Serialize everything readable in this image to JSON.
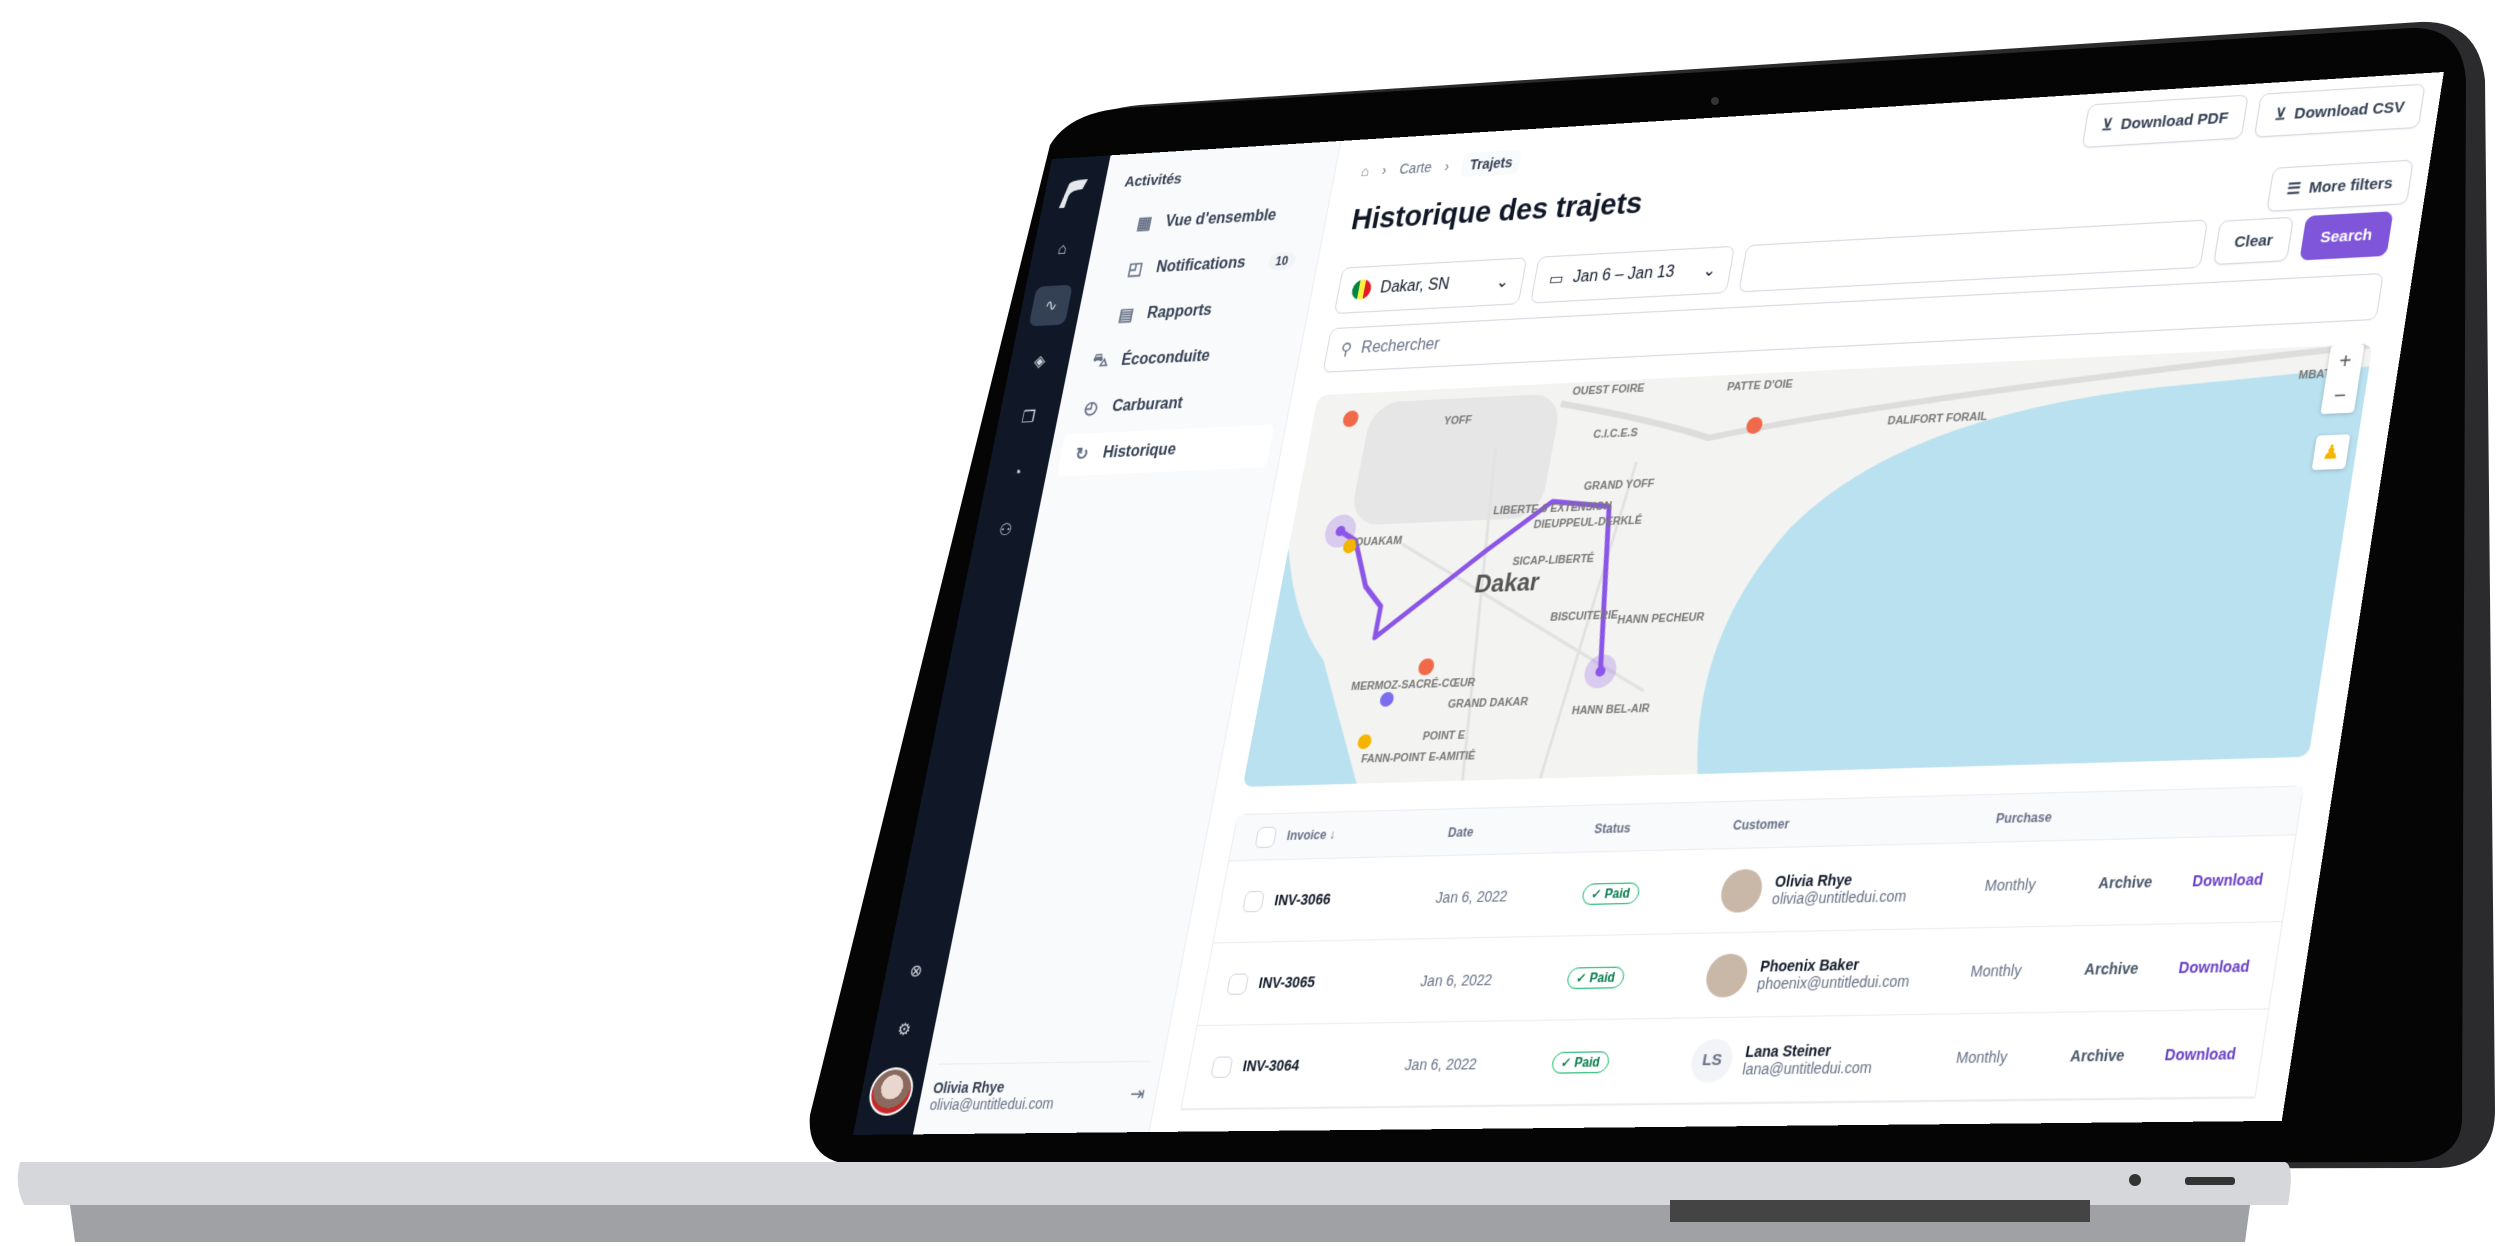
{
  "colors": {
    "accent": "#7f56d9",
    "rail": "#101828",
    "paid": "#12b76a",
    "water": "#b9e1f0",
    "route": "#8b55e8"
  },
  "rail": {
    "icons": [
      "logo",
      "home-icon",
      "activity-icon",
      "layers-icon",
      "copy-icon",
      "pie-chart-icon",
      "users-icon",
      "lifebuoy-icon",
      "settings-icon"
    ]
  },
  "sidebar": {
    "heading": "Activités",
    "items": [
      {
        "label": "Vue d'ensemble",
        "icon": "layout-icon"
      },
      {
        "label": "Notifications",
        "icon": "notification-icon",
        "badge": "10"
      },
      {
        "label": "Rapports",
        "icon": "file-icon"
      },
      {
        "label": "Écoconduite",
        "icon": "car-icon"
      },
      {
        "label": "Carburant",
        "icon": "speedometer-icon"
      },
      {
        "label": "Historique",
        "icon": "history-icon",
        "active": true
      }
    ],
    "user": {
      "name": "Olivia Rhye",
      "email": "olivia@untitledui.com"
    }
  },
  "breadcrumb": [
    "Carte",
    "Trajets"
  ],
  "header": {
    "title": "Historique des trajets",
    "download_pdf": "Download PDF",
    "download_csv": "Download CSV",
    "more_filters": "More filters"
  },
  "filters": {
    "location": "Dakar, SN",
    "date_range": "Jan 6 – Jan 13",
    "query": "",
    "clear": "Clear",
    "search": "Search"
  },
  "search": {
    "placeholder": "Rechercher"
  },
  "map": {
    "labels": [
      "OUEST FOIRE",
      "PATTE D'OIE",
      "YOFF",
      "C.I.C.E.S",
      "DALIFORT FORAIL",
      "MBATAL",
      "GRAND YOFF",
      "LIBERTE 6 EXTENSION",
      "DIEUPPEUL-DERKLÉ",
      "SICAP-LIBERTÉ",
      "Dakar",
      "BISCUITERIE",
      "HANN PECHEUR",
      "MERMOZ-SACRÉ-CŒUR",
      "GRAND DAKAR",
      "HANN BEL-AIR",
      "POINT E",
      "FANN-POINT E-AMITIÉ",
      "OUAKAM"
    ],
    "zoom_in": "+",
    "zoom_out": "−"
  },
  "table": {
    "headers": [
      "Invoice",
      "Date",
      "Status",
      "Customer",
      "Purchase"
    ],
    "rows": [
      {
        "invoice": "INV-3066",
        "date": "Jan 6, 2022",
        "status": "Paid",
        "name": "Olivia Rhye",
        "email": "olivia@untitledui.com",
        "purchase": "Monthly",
        "archive": "Archive",
        "download": "Download"
      },
      {
        "invoice": "INV-3065",
        "date": "Jan 6, 2022",
        "status": "Paid",
        "name": "Phoenix Baker",
        "email": "phoenix@untitledui.com",
        "purchase": "Monthly",
        "archive": "Archive",
        "download": "Download"
      },
      {
        "invoice": "INV-3064",
        "date": "Jan 6, 2022",
        "status": "Paid",
        "name": "Lana Steiner",
        "email": "lana@untitledui.com",
        "initials": "LS",
        "purchase": "Monthly",
        "archive": "Archive",
        "download": "Download"
      }
    ]
  }
}
